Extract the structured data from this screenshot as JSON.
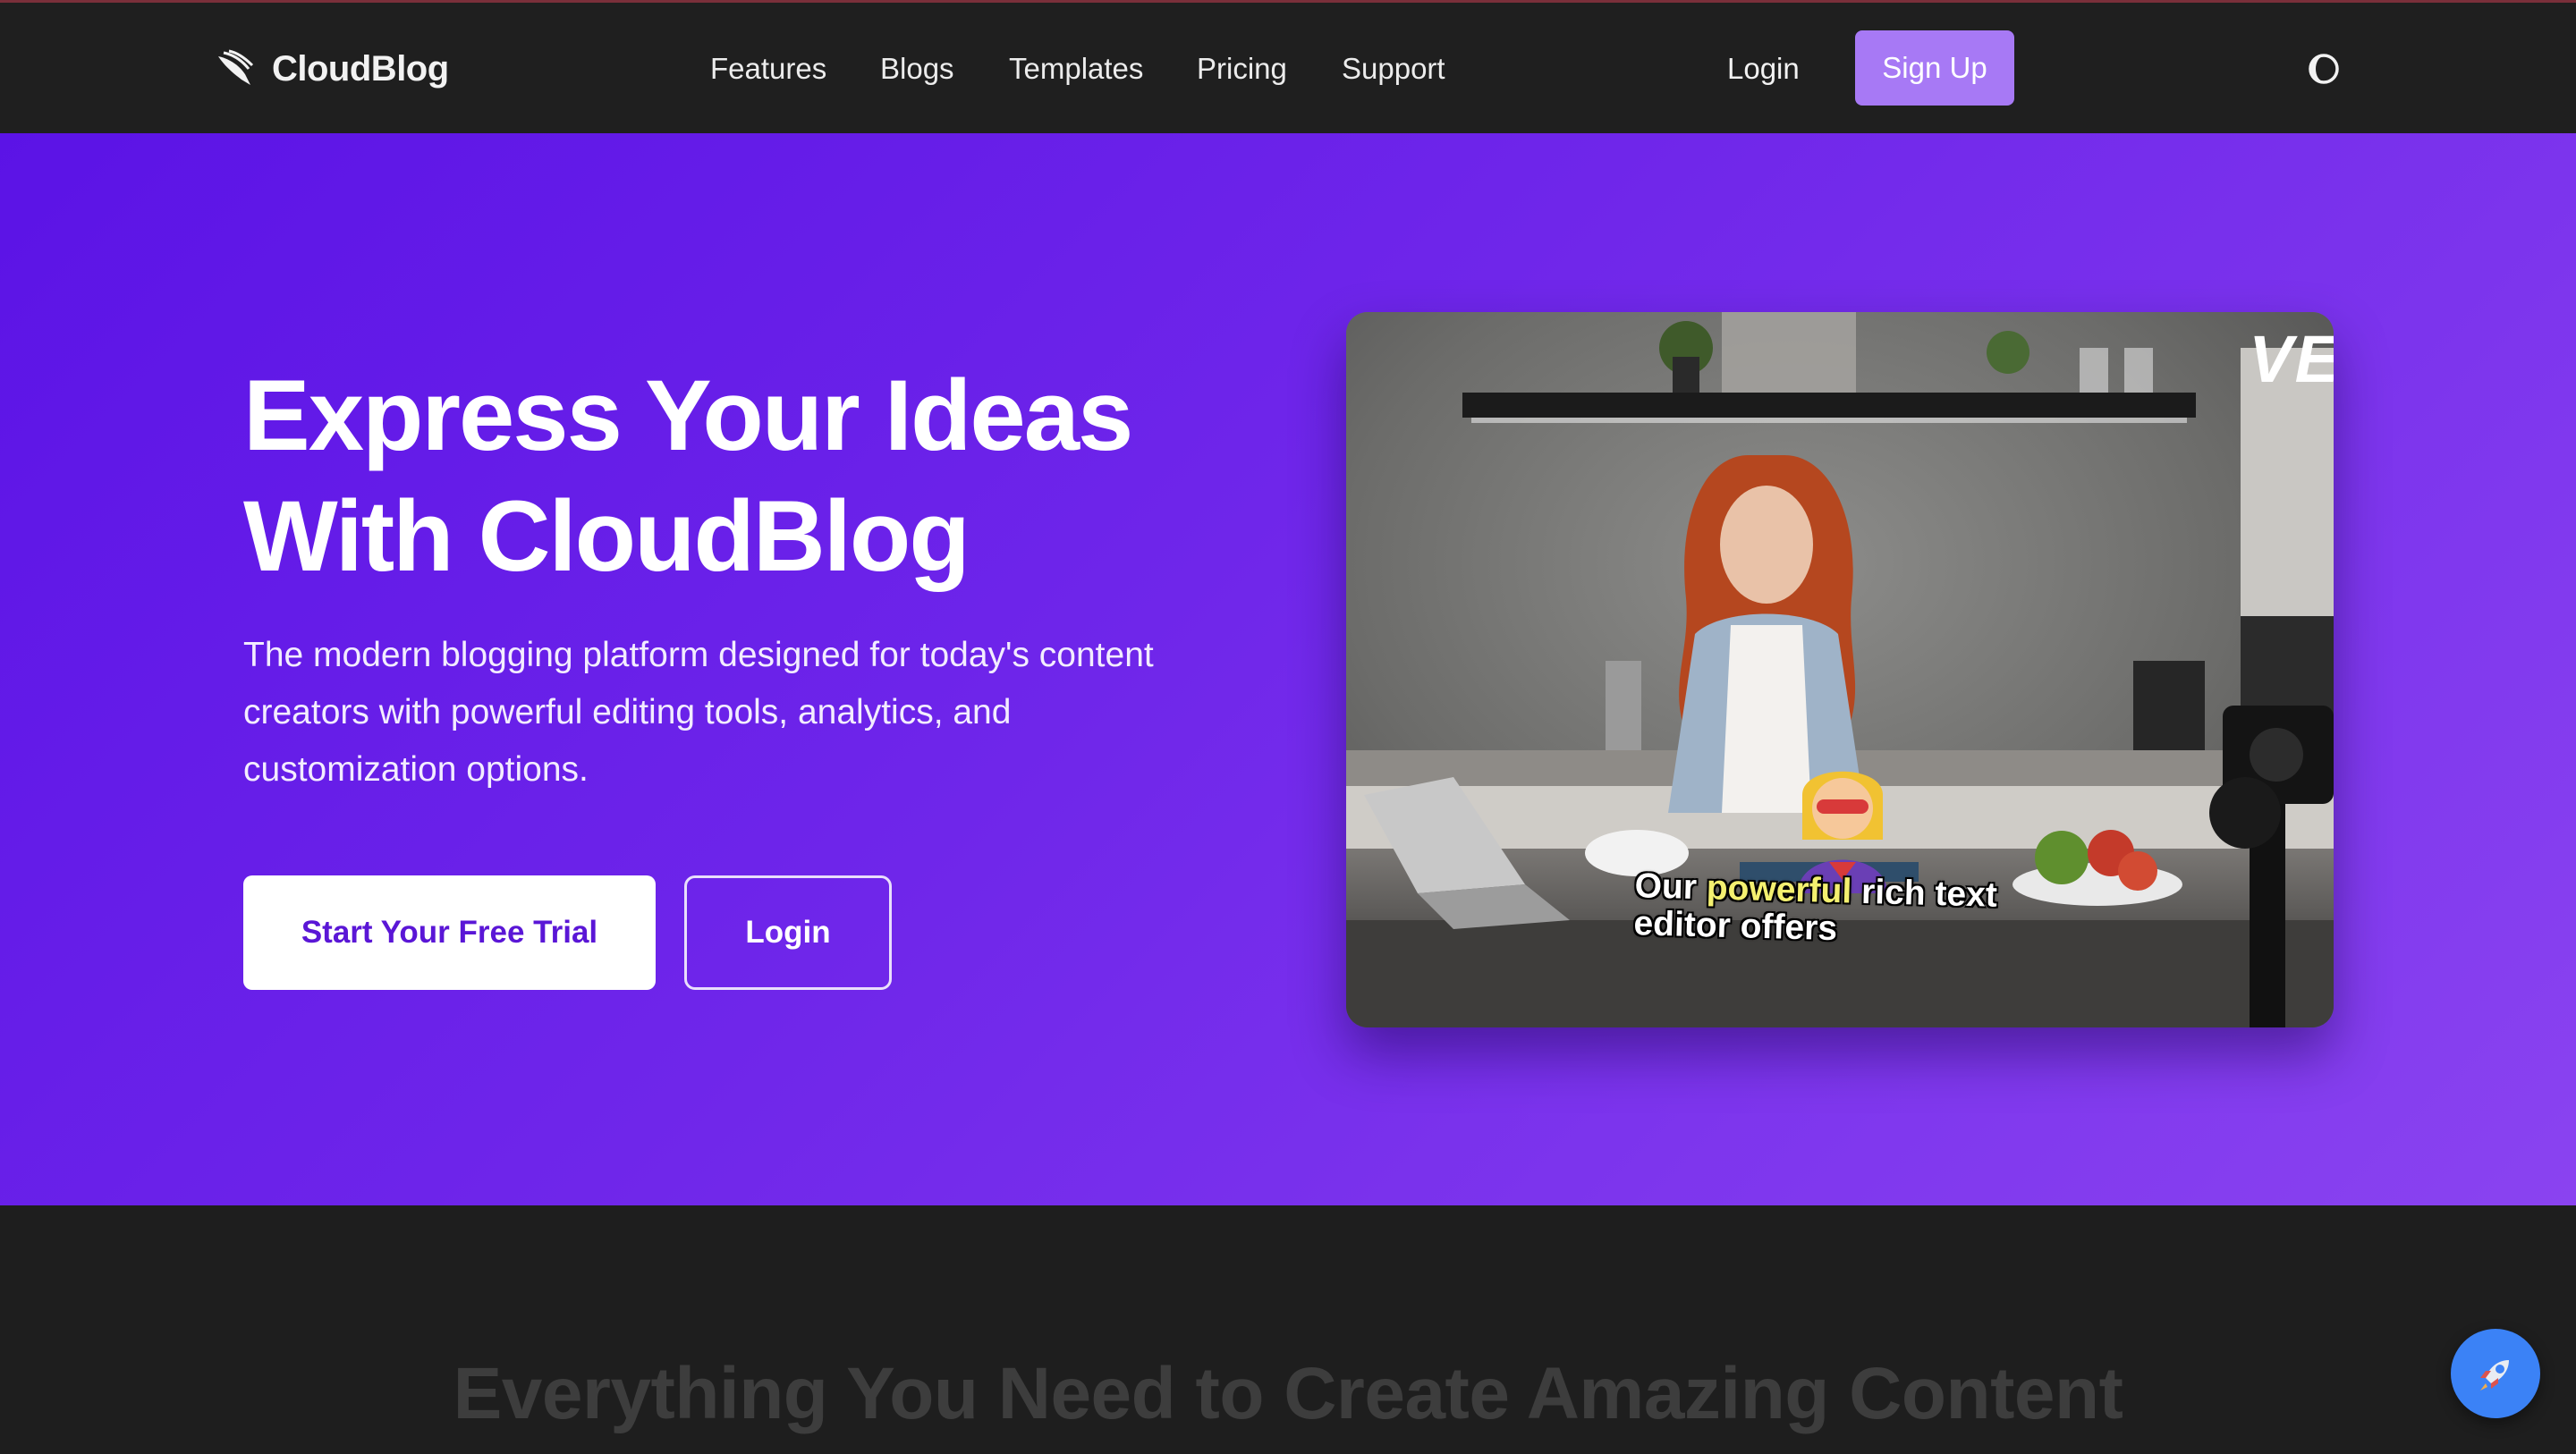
{
  "header": {
    "brand": "CloudBlog",
    "nav": [
      "Features",
      "Blogs",
      "Templates",
      "Pricing",
      "Support"
    ],
    "login": "Login",
    "signup": "Sign Up",
    "theme_icon": "theme-toggle-icon"
  },
  "hero": {
    "title_lines": [
      "Express Your Ideas",
      "With CloudBlog"
    ],
    "subtitle_lines": [
      "The modern blogging platform designed for today's content",
      "creators with powerful editing tools, analytics, and",
      "customization options."
    ],
    "cta_primary": "Start Your Free Trial",
    "cta_secondary": "Login"
  },
  "video": {
    "watermark": "VE",
    "caption_line1_pre": "Our",
    "caption_highlight": "powerful",
    "caption_line1_post": "rich text",
    "caption_line2": "editor offers"
  },
  "features_section": {
    "title": "Everything You Need to Create Amazing Content"
  },
  "floating_button": {
    "icon": "rocket-icon"
  },
  "colors": {
    "accent": "#a779f5",
    "hero_start": "#5b13e6",
    "hero_end": "#8a43f0",
    "fab": "#3b82f6"
  }
}
